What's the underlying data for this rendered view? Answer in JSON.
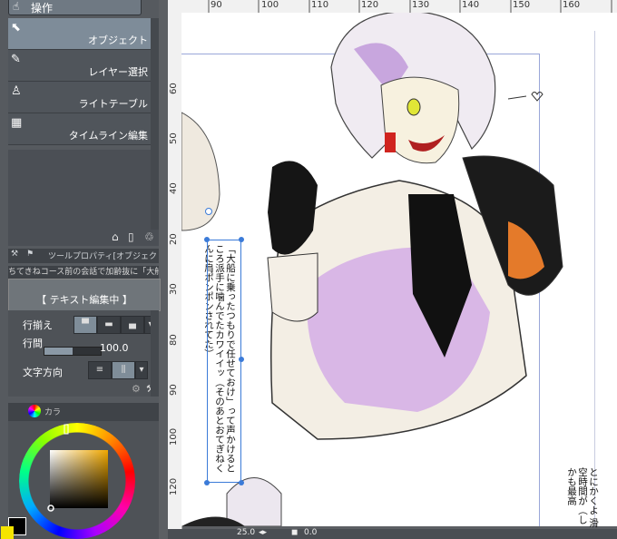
{
  "tool_palette": {
    "header": "操作",
    "subtools": [
      {
        "label": "オブジェクト",
        "icon": "pointer-icon",
        "selected": true
      },
      {
        "label": "レイヤー選択",
        "icon": "layer-select-icon",
        "selected": false
      },
      {
        "label": "ライトテーブル",
        "icon": "light-table-icon",
        "selected": false
      },
      {
        "label": "タイムライン編集",
        "icon": "timeline-icon",
        "selected": false
      }
    ]
  },
  "tool_property": {
    "tab_label": "ツールプロパティ[オブジェク",
    "document_text": "ちてきねコース前の会話で加齢抜に「大船に",
    "mode_label": "【 テキスト編集中 】",
    "align_label": "行揃え",
    "line_spacing_label": "行間",
    "line_spacing_value": "100.0",
    "line_spacing_fraction": 0.5,
    "direction_label": "文字方向"
  },
  "color_panel": {
    "tab_label": "カラ"
  },
  "rulers": {
    "horizontal_ticks": [
      "90",
      "100",
      "110",
      "120",
      "130",
      "140",
      "150",
      "160"
    ],
    "vertical_ticks": [
      "20",
      "30",
      "40",
      "50",
      "60",
      "70",
      "80",
      "90",
      "100",
      "110",
      "120"
    ]
  },
  "status_bar": {
    "zoom": "25.0",
    "angle": "0.0"
  },
  "canvas": {
    "text_main": "「大船に乗ったつもりで任せておけ」って声かけるところ派手に噛んでたカワイイッ（そのあとおてぎねくんに肩ポンポンされてた）",
    "text_secondary": "とにかくよ 滑空時間が（しかも最高"
  }
}
